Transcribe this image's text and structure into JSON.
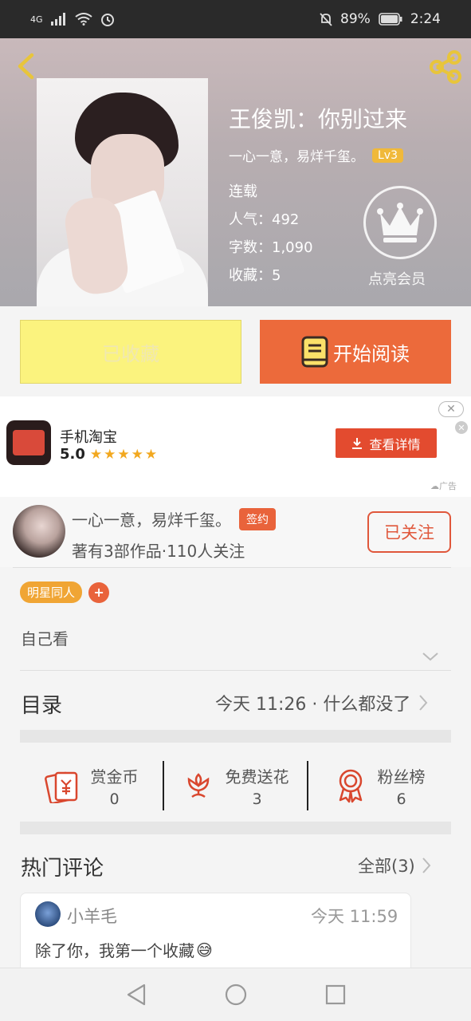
{
  "status_bar": {
    "network": "4G",
    "battery": "89%",
    "time": "2:24"
  },
  "book": {
    "title": "王俊凯：你别过来",
    "author": "一心一意，易烊千玺。",
    "author_level": "Lv3",
    "status": "连载",
    "popularity": "人气：492",
    "word_count": "字数：1,090",
    "favorites": "收藏：5",
    "vip_label": "点亮会员"
  },
  "actions": {
    "collected_label": "已收藏",
    "read_label": "开始阅读"
  },
  "ad": {
    "app_name": "手机淘宝",
    "rating": "5.0",
    "stars": "★★★★★",
    "button_label": "查看详情",
    "ad_tag": "广告",
    "close_label": "✕",
    "close_small": "✕"
  },
  "author_card": {
    "name": "一心一意，易烊千玺。",
    "badge": "签约",
    "stats": "著有3部作品·110人关注",
    "follow_label": "已关注"
  },
  "tags": {
    "items": [
      "明星同人"
    ],
    "add_label": "+"
  },
  "intro": "自己看",
  "toc": {
    "title": "目录",
    "latest": "今天 11:26 · 什么都没了"
  },
  "stats": {
    "coins_label": "赏金币",
    "coins_value": "0",
    "flowers_label": "免费送花",
    "flowers_value": "3",
    "fans_label": "粉丝榜",
    "fans_value": "6"
  },
  "comments": {
    "title": "热门评论",
    "all_label": "全部(3)",
    "items": [
      {
        "user": "小羊毛",
        "time": "今天 11:59",
        "text": "除了你，我第一个收藏",
        "emoji": "😅"
      }
    ]
  },
  "colors": {
    "accent_orange": "#ec6a3b",
    "collected_yellow": "#fbf37e",
    "tag_orange": "#f0a534",
    "level_gold": "#f0b93a"
  }
}
